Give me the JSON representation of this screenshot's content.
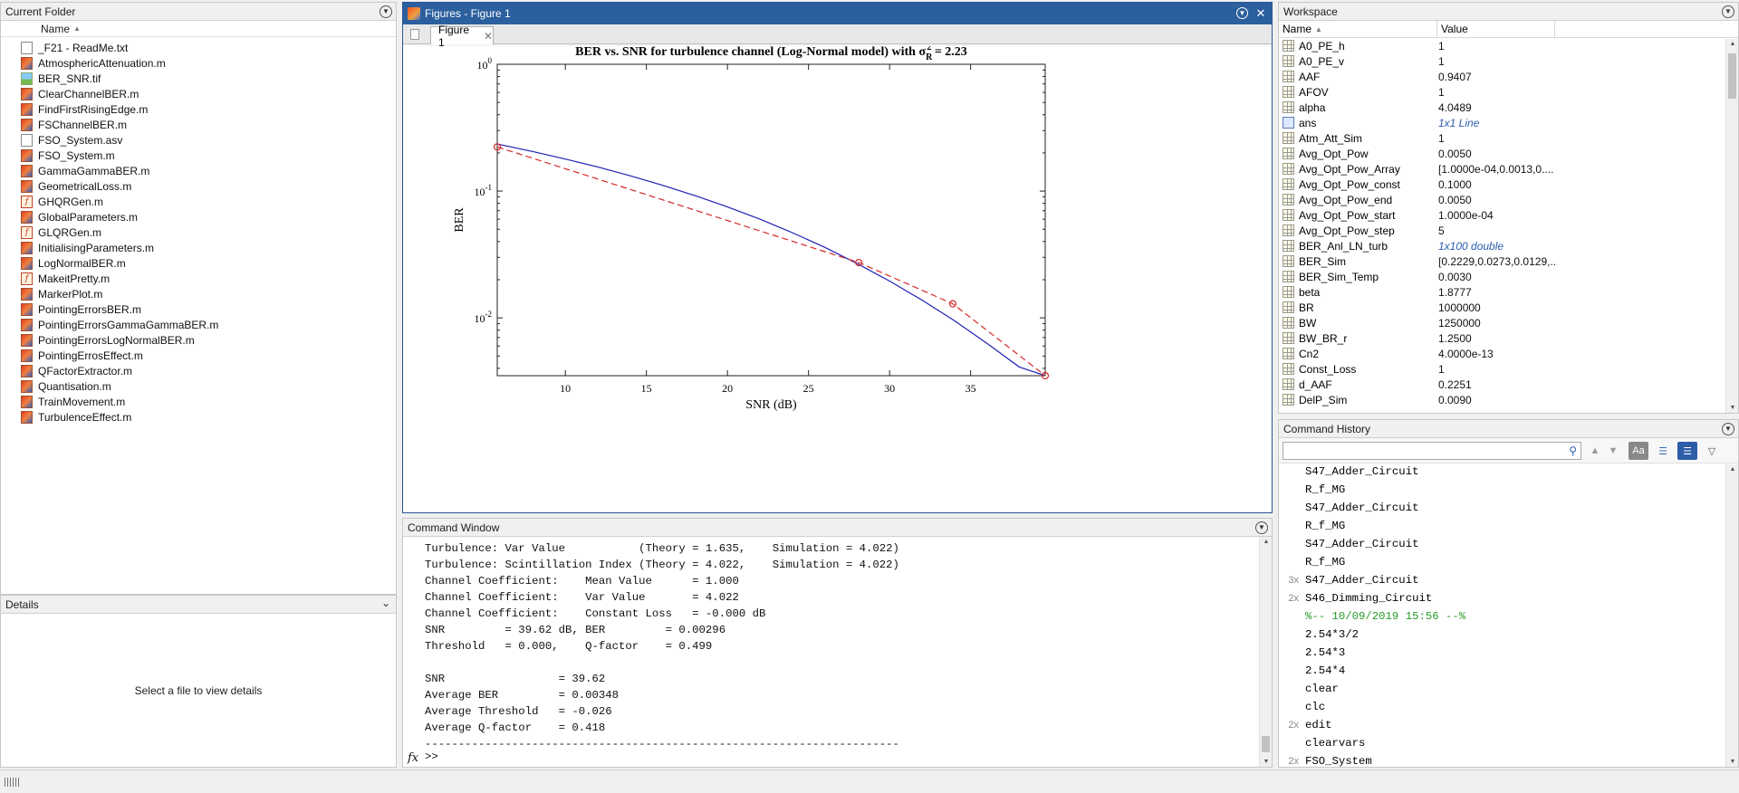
{
  "current_folder": {
    "title": "Current Folder",
    "column_name": "Name",
    "files": [
      {
        "name": "_F21 - ReadMe.txt",
        "type": "txt"
      },
      {
        "name": "AtmosphericAttenuation.m",
        "type": "m"
      },
      {
        "name": "BER_SNR.tif",
        "type": "tif"
      },
      {
        "name": "ClearChannelBER.m",
        "type": "m"
      },
      {
        "name": "FindFirstRisingEdge.m",
        "type": "m"
      },
      {
        "name": "FSChannelBER.m",
        "type": "m"
      },
      {
        "name": "FSO_System.asv",
        "type": "asv"
      },
      {
        "name": "FSO_System.m",
        "type": "m"
      },
      {
        "name": "GammaGammaBER.m",
        "type": "m"
      },
      {
        "name": "GeometricalLoss.m",
        "type": "m"
      },
      {
        "name": "GHQRGen.m",
        "type": "fn"
      },
      {
        "name": "GlobalParameters.m",
        "type": "m"
      },
      {
        "name": "GLQRGen.m",
        "type": "fn"
      },
      {
        "name": "InitialisingParameters.m",
        "type": "m"
      },
      {
        "name": "LogNormalBER.m",
        "type": "m"
      },
      {
        "name": "MakeitPretty.m",
        "type": "fn"
      },
      {
        "name": "MarkerPlot.m",
        "type": "m"
      },
      {
        "name": "PointingErrorsBER.m",
        "type": "m"
      },
      {
        "name": "PointingErrorsGammaGammaBER.m",
        "type": "m"
      },
      {
        "name": "PointingErrorsLogNormalBER.m",
        "type": "m"
      },
      {
        "name": "PointingErrosEffect.m",
        "type": "m"
      },
      {
        "name": "QFactorExtractor.m",
        "type": "m"
      },
      {
        "name": "Quantisation.m",
        "type": "m"
      },
      {
        "name": "TrainMovement.m",
        "type": "m"
      },
      {
        "name": "TurbulenceEffect.m",
        "type": "m"
      }
    ]
  },
  "details": {
    "title": "Details",
    "empty_message": "Select a file to view details"
  },
  "figures": {
    "window_title": "Figures - Figure 1",
    "tab_label": "Figure 1",
    "line_color": "#1f1fb4",
    "sim_color": "#d62728"
  },
  "chart_data": {
    "type": "line",
    "title": "BER vs. SNR for turbulence channel (Log-Normal model) with σ",
    "title_sub": "R",
    "title_sup": "2",
    "title_tail": " = 2.23",
    "xlabel": "SNR (dB)",
    "ylabel": "BER",
    "xlim": [
      5.8,
      39.6
    ],
    "ylim": [
      0.0035,
      1
    ],
    "yscale": "log",
    "x_ticks": [
      10,
      15,
      20,
      25,
      30,
      35
    ],
    "y_ticks": [
      {
        "value": 1,
        "base": "10",
        "exp": "0"
      },
      {
        "value": 0.1,
        "base": "10",
        "exp": "-1"
      },
      {
        "value": 0.01,
        "base": "10",
        "exp": "-2"
      }
    ],
    "series": [
      {
        "style": "solid",
        "x": [
          5.8,
          8,
          10,
          12,
          14,
          16,
          18,
          20,
          22,
          24,
          26,
          28,
          30,
          32,
          34,
          36,
          38,
          39.6
        ],
        "values": [
          0.235,
          0.205,
          0.179,
          0.155,
          0.132,
          0.111,
          0.092,
          0.075,
          0.06,
          0.047,
          0.036,
          0.0268,
          0.0195,
          0.0138,
          0.0095,
          0.0063,
          0.0041,
          0.0035
        ]
      },
      {
        "style": "dashed",
        "markers": "circle",
        "x": [
          5.8,
          28.1,
          33.9,
          39.6
        ],
        "values": [
          0.2229,
          0.0273,
          0.0129,
          0.0035
        ],
        "marker_x": [
          5.8,
          28.1,
          33.9,
          39.6
        ],
        "marker_values": [
          0.2229,
          0.0273,
          0.0129,
          0.0035
        ]
      }
    ]
  },
  "workspace": {
    "title": "Workspace",
    "col_name": "Name",
    "col_value": "Value",
    "vars": [
      {
        "name": "A0_PE_h",
        "value": "1"
      },
      {
        "name": "A0_PE_v",
        "value": "1"
      },
      {
        "name": "AAF",
        "value": "0.9407"
      },
      {
        "name": "AFOV",
        "value": "1"
      },
      {
        "name": "alpha",
        "value": "4.0489"
      },
      {
        "name": "ans",
        "value": "1x1 Line",
        "italic": true,
        "obj": true
      },
      {
        "name": "Atm_Att_Sim",
        "value": "1"
      },
      {
        "name": "Avg_Opt_Pow",
        "value": "0.0050"
      },
      {
        "name": "Avg_Opt_Pow_Array",
        "value": "[1.0000e-04,0.0013,0...."
      },
      {
        "name": "Avg_Opt_Pow_const",
        "value": "0.1000"
      },
      {
        "name": "Avg_Opt_Pow_end",
        "value": "0.0050"
      },
      {
        "name": "Avg_Opt_Pow_start",
        "value": "1.0000e-04"
      },
      {
        "name": "Avg_Opt_Pow_step",
        "value": "5"
      },
      {
        "name": "BER_Anl_LN_turb",
        "value": "1x100 double",
        "italic": true
      },
      {
        "name": "BER_Sim",
        "value": "[0.2229,0.0273,0.0129,..."
      },
      {
        "name": "BER_Sim_Temp",
        "value": "0.0030"
      },
      {
        "name": "beta",
        "value": "1.8777"
      },
      {
        "name": "BR",
        "value": "1000000"
      },
      {
        "name": "BW",
        "value": "1250000"
      },
      {
        "name": "BW_BR_r",
        "value": "1.2500"
      },
      {
        "name": "Cn2",
        "value": "4.0000e-13"
      },
      {
        "name": "Const_Loss",
        "value": "1"
      },
      {
        "name": "d_AAF",
        "value": "0.2251"
      },
      {
        "name": "DelP_Sim",
        "value": "0.0090"
      }
    ]
  },
  "command_window": {
    "title": "Command Window",
    "lines": [
      "Turbulence: Var Value           (Theory = 1.635,    Simulation = 4.022)",
      "Turbulence: Scintillation Index (Theory = 4.022,    Simulation = 4.022)",
      "Channel Coefficient:    Mean Value      = 1.000",
      "Channel Coefficient:    Var Value       = 4.022",
      "Channel Coefficient:    Constant Loss   = -0.000 dB",
      "SNR         = 39.62 dB, BER         = 0.00296",
      "Threshold   = 0.000,    Q-factor    = 0.499",
      "",
      "SNR                 = 39.62",
      "Average BER         = 0.00348",
      "Average Threshold   = -0.026",
      "Average Q-factor    = 0.418",
      "-----------------------------------------------------------------------"
    ],
    "prompt": ">>",
    "fx_label": "fx"
  },
  "command_history": {
    "title": "Command History",
    "entries": [
      {
        "text": "S47_Adder_Circuit",
        "count": ""
      },
      {
        "text": "R_f_MG",
        "count": ""
      },
      {
        "text": "S47_Adder_Circuit",
        "count": ""
      },
      {
        "text": "R_f_MG",
        "count": ""
      },
      {
        "text": "S47_Adder_Circuit",
        "count": ""
      },
      {
        "text": "R_f_MG",
        "count": ""
      },
      {
        "text": "S47_Adder_Circuit",
        "count": "3x"
      },
      {
        "text": "S46_Dimming_Circuit",
        "count": "2x"
      },
      {
        "text": "%-- 10/09/2019 15:56 --%",
        "count": "",
        "session": true
      },
      {
        "text": "2.54*3/2",
        "count": ""
      },
      {
        "text": "2.54*3",
        "count": ""
      },
      {
        "text": "2.54*4",
        "count": ""
      },
      {
        "text": "clear",
        "count": ""
      },
      {
        "text": "clc",
        "count": ""
      },
      {
        "text": "edit",
        "count": "2x"
      },
      {
        "text": "clearvars",
        "count": ""
      },
      {
        "text": "FSO_System",
        "count": "2x"
      }
    ]
  }
}
